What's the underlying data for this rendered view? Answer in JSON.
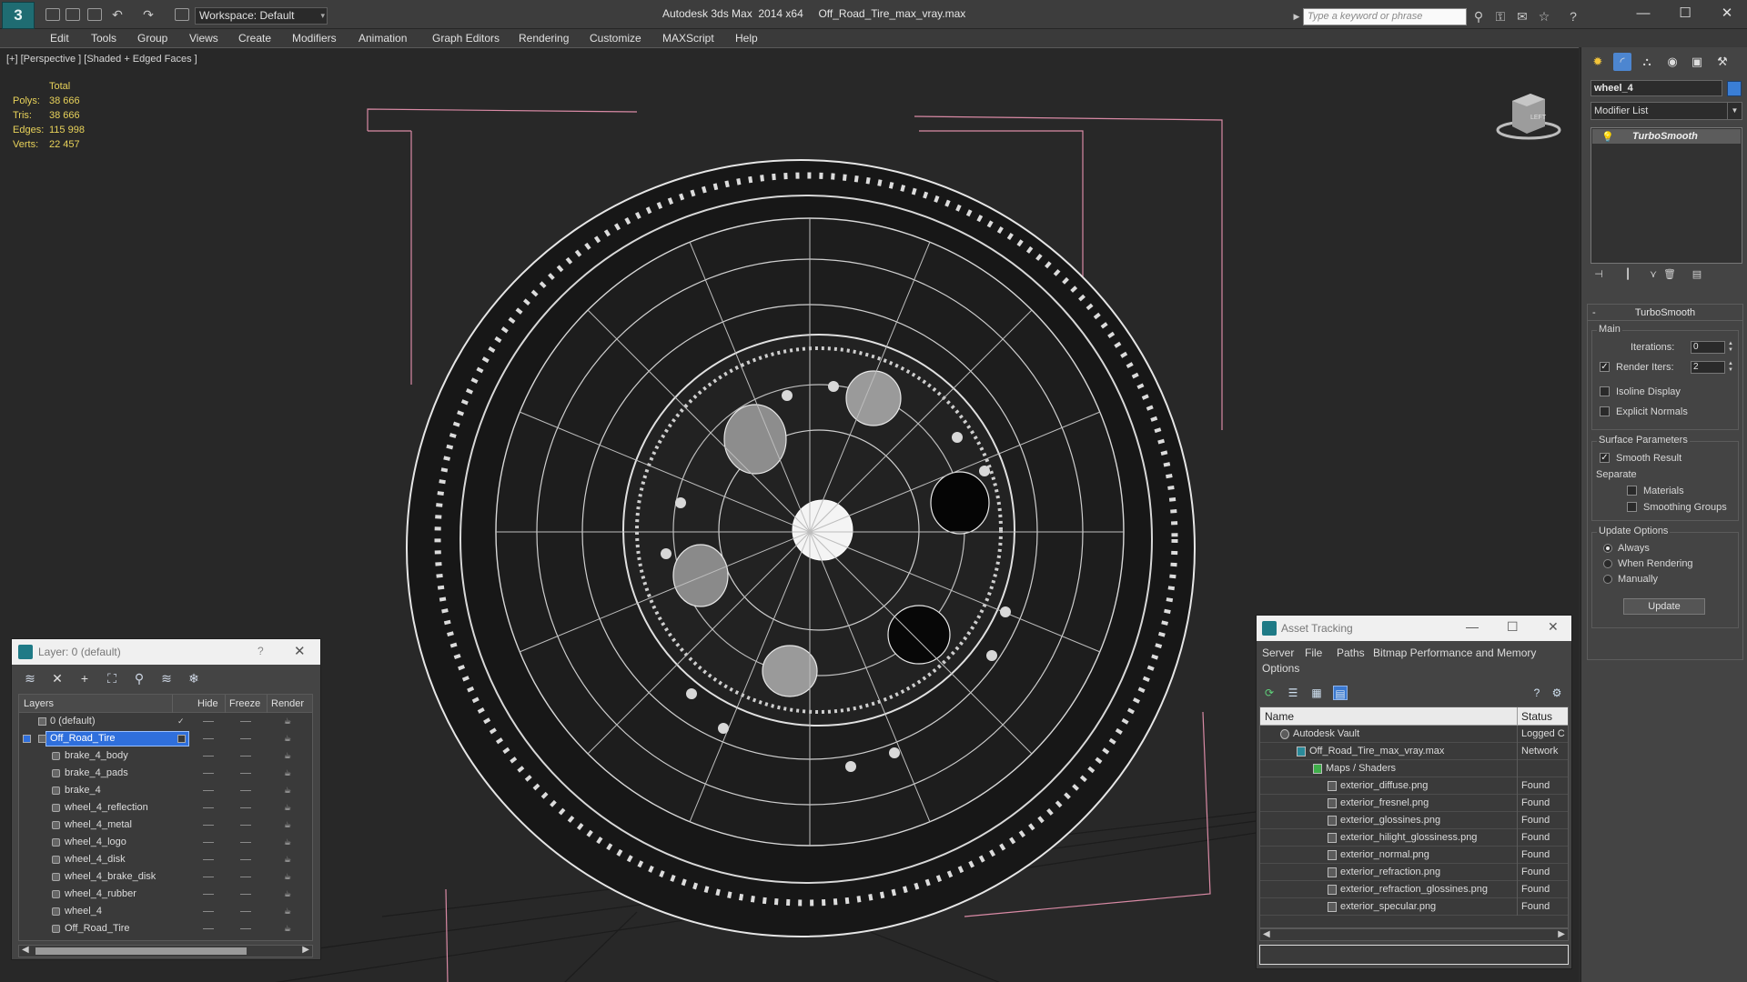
{
  "titlebar": {
    "workspace": "Workspace: Default",
    "app_title": "Autodesk 3ds Max  2014 x64",
    "file_title": "Off_Road_Tire_max_vray.max",
    "search_placeholder": "Type a keyword or phrase"
  },
  "menu": [
    "Edit",
    "Tools",
    "Group",
    "Views",
    "Create",
    "Modifiers",
    "Animation",
    "Graph Editors",
    "Rendering",
    "Customize",
    "MAXScript",
    "Help"
  ],
  "viewport": {
    "label": "[+] [Perspective ] [Shaded + Edged Faces ]",
    "stats": {
      "header": "Total",
      "rows": [
        {
          "k": "Polys:",
          "v": "38 666"
        },
        {
          "k": "Tris:",
          "v": "38 666"
        },
        {
          "k": "Edges:",
          "v": "115 998"
        },
        {
          "k": "Verts:",
          "v": "22 457"
        }
      ]
    },
    "viewcube_label": "LEFT"
  },
  "command_panel": {
    "object_name": "wheel_4",
    "object_color": "#3a7ed6",
    "modifier_list": "Modifier List",
    "stack_item": "TurboSmooth",
    "rollout_title": "TurboSmooth",
    "main_group": "Main",
    "iterations_label": "Iterations:",
    "iterations_value": "0",
    "render_iters_label": "Render Iters:",
    "render_iters_value": "2",
    "isoline_display": "Isoline Display",
    "explicit_normals": "Explicit Normals",
    "surface_group": "Surface Parameters",
    "smooth_result": "Smooth Result",
    "separate": "Separate",
    "materials": "Materials",
    "smoothing_groups": "Smoothing Groups",
    "update_group": "Update Options",
    "always": "Always",
    "when_rendering": "When Rendering",
    "manually": "Manually",
    "update_button": "Update"
  },
  "layer_panel": {
    "title": "Layer: 0 (default)",
    "help": "?",
    "columns": {
      "layers": "Layers",
      "hide": "Hide",
      "freeze": "Freeze",
      "render": "Render"
    },
    "rows": [
      {
        "name": "0 (default)",
        "level": 1,
        "current": true
      },
      {
        "name": "Off_Road_Tire",
        "level": 1,
        "selected": true
      },
      {
        "name": "brake_4_body",
        "level": 2
      },
      {
        "name": "brake_4_pads",
        "level": 2
      },
      {
        "name": "brake_4",
        "level": 2
      },
      {
        "name": "wheel_4_reflection",
        "level": 2
      },
      {
        "name": "wheel_4_metal",
        "level": 2
      },
      {
        "name": "wheel_4_logo",
        "level": 2
      },
      {
        "name": "wheel_4_disk",
        "level": 2
      },
      {
        "name": "wheel_4_brake_disk",
        "level": 2
      },
      {
        "name": "wheel_4_rubber",
        "level": 2
      },
      {
        "name": "wheel_4",
        "level": 2
      },
      {
        "name": "Off_Road_Tire",
        "level": 2
      }
    ]
  },
  "asset_panel": {
    "title": "Asset Tracking",
    "menu": [
      "Server",
      "File",
      "Paths",
      "Bitmap Performance and Memory",
      "Options"
    ],
    "columns": {
      "name": "Name",
      "status": "Status"
    },
    "rows": [
      {
        "name": "Autodesk Vault",
        "status": "Logged C",
        "level": 1
      },
      {
        "name": "Off_Road_Tire_max_vray.max",
        "status": "Network",
        "level": 2
      },
      {
        "name": "Maps / Shaders",
        "status": "",
        "level": 3
      },
      {
        "name": "exterior_diffuse.png",
        "status": "Found",
        "level": 4
      },
      {
        "name": "exterior_fresnel.png",
        "status": "Found",
        "level": 4
      },
      {
        "name": "exterior_glossines.png",
        "status": "Found",
        "level": 4
      },
      {
        "name": "exterior_hilight_glossiness.png",
        "status": "Found",
        "level": 4
      },
      {
        "name": "exterior_normal.png",
        "status": "Found",
        "level": 4
      },
      {
        "name": "exterior_refraction.png",
        "status": "Found",
        "level": 4
      },
      {
        "name": "exterior_refraction_glossines.png",
        "status": "Found",
        "level": 4
      },
      {
        "name": "exterior_specular.png",
        "status": "Found",
        "level": 4
      }
    ]
  }
}
